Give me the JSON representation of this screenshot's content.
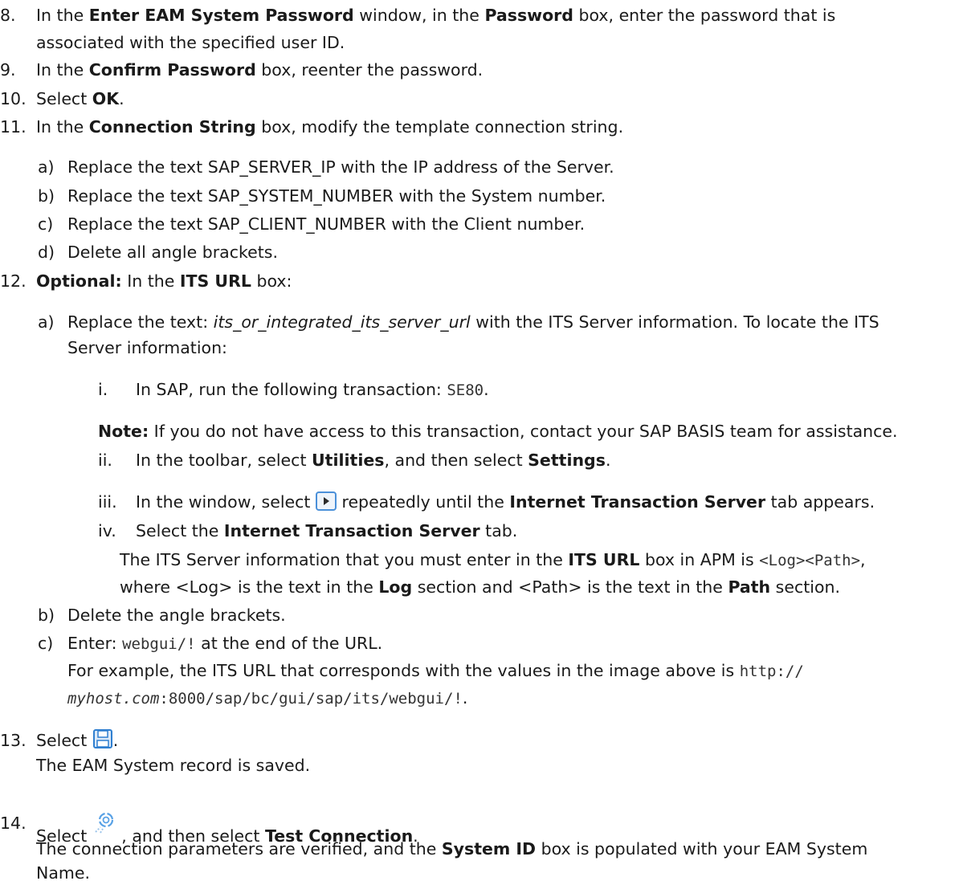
{
  "steps": {
    "s8": {
      "num": "8.",
      "a": "In the ",
      "b1": "Enter EAM System Password",
      "c": " window, in the ",
      "b2": "Password",
      "d": " box, enter the password that is",
      "line2": "associated with the specified user ID."
    },
    "s9": {
      "num": "9.",
      "a": "In the ",
      "b1": "Confirm Password",
      "c": " box, reenter the password."
    },
    "s10": {
      "num": "10.",
      "a": "Select ",
      "b1": "OK",
      "c": "."
    },
    "s11": {
      "num": "11.",
      "a": "In the ",
      "b1": "Connection String",
      "c": " box, modify the template connection string.",
      "subs": [
        {
          "letter": "a)",
          "text": "Replace the text SAP_SERVER_IP with the IP address of the Server."
        },
        {
          "letter": "b)",
          "text": "Replace the text SAP_SYSTEM_NUMBER with the System number."
        },
        {
          "letter": "c)",
          "text": "Replace the text SAP_CLIENT_NUMBER with the Client number."
        },
        {
          "letter": "d)",
          "text": "Delete all angle brackets."
        }
      ]
    },
    "s12": {
      "num": "12.",
      "b1": "Optional:",
      "a": " In the ",
      "b2": "ITS URL",
      "c": " box:",
      "a_letter": "a)",
      "a_text1": "Replace the text: ",
      "a_italic": "its_or_integrated_its_server_url",
      "a_text2": " with the ITS Server information. To locate the ITS",
      "a_line2": "Server information:",
      "i_num": "i.",
      "i_text": "In SAP, run the following transaction: ",
      "i_code": "SE80",
      "i_end": ".",
      "note_label": "Note:",
      "note_text": " If you do not have access to this transaction, contact your SAP BASIS team for assistance.",
      "ii_num": "ii.",
      "ii_a": "In the toolbar, select ",
      "ii_b1": "Utilities",
      "ii_c": ", and then select ",
      "ii_b2": "Settings",
      "ii_d": ".",
      "iii_num": "iii.",
      "iii_a": "In the window, select ",
      "iii_b": " repeatedly until the ",
      "iii_b1": "Internet Transaction Server",
      "iii_c": " tab appears.",
      "iv_num": "iv.",
      "iv_a": "Select the ",
      "iv_b1": "Internet Transaction Server",
      "iv_c": " tab.",
      "iv_l2a": "The ITS Server information that you must enter in the ",
      "iv_l2b": "ITS URL",
      "iv_l2c": " box in APM is ",
      "iv_l2code": "<Log><Path>",
      "iv_l2d": ",",
      "iv_l3a": "where <Log> is the text in the ",
      "iv_l3b": "Log",
      "iv_l3c": " section and <Path> is the text in the ",
      "iv_l3d": "Path",
      "iv_l3e": " section.",
      "b_letter": "b)",
      "b_text": "Delete the angle brackets.",
      "c_letter": "c)",
      "c_a": "Enter: ",
      "c_code": "webgui/!",
      "c_b": " at the end of the URL.",
      "c_l2a": "For example, the ITS URL that corresponds with the values in the image above is ",
      "c_l2code": "http://",
      "c_l3italic": "myhost.com",
      "c_l3code": ":8000/sap/bc/gui/sap/its/webgui/!",
      "c_l3end": "."
    },
    "s13": {
      "num": "13.",
      "a": "Select ",
      "end": ".",
      "line2": "The EAM System record is saved."
    },
    "s14": {
      "num": "14.",
      "a": "Select ",
      "b": " , and then select ",
      "b1": "Test Connection",
      "c": ".",
      "line2a": "The connection parameters are verified, and the ",
      "line2b": "System ID",
      "line2c": " box is populated with your EAM System",
      "line3": "Name."
    }
  },
  "icons": {
    "next": "next-arrow-icon",
    "save": "save-disk-icon",
    "connection": "connection-icon"
  },
  "colors": {
    "icon_blue": "#2f7fd0",
    "icon_frame": "#4a90d9"
  }
}
